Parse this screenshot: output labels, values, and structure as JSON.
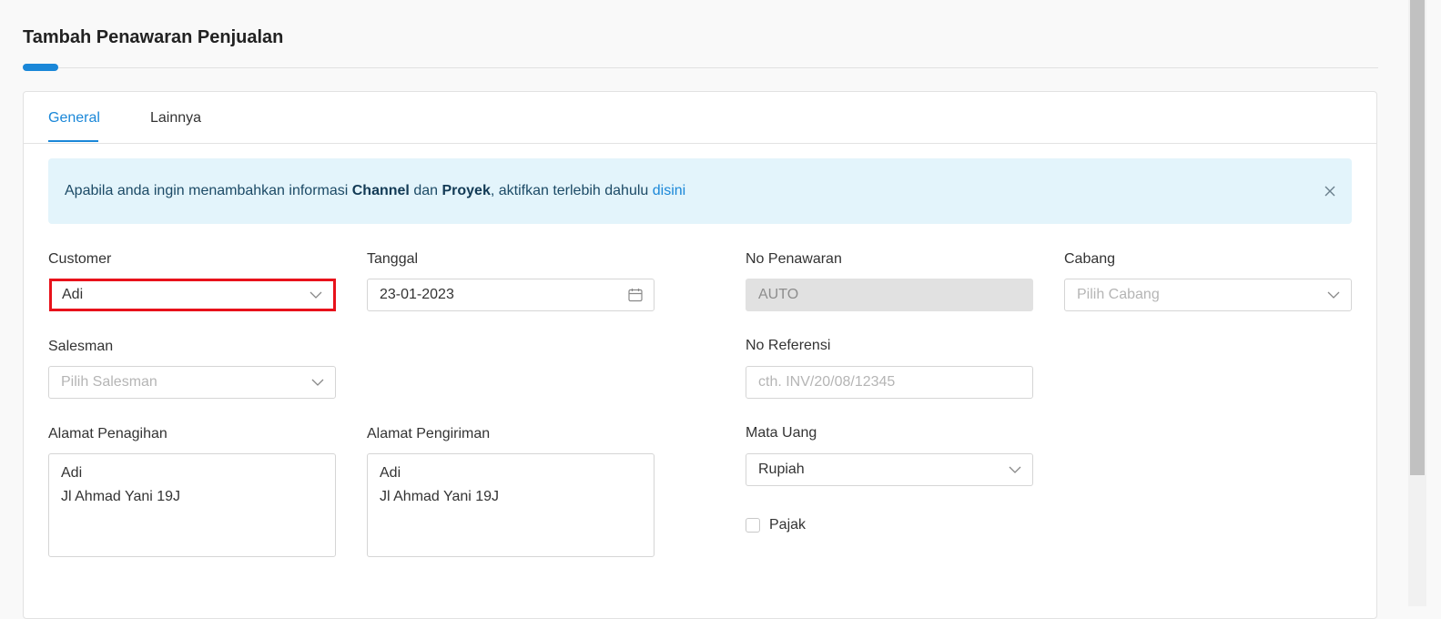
{
  "page_title": "Tambah Penawaran Penjualan",
  "tabs": [
    {
      "label": "General",
      "active": true
    },
    {
      "label": "Lainnya",
      "active": false
    }
  ],
  "alert": {
    "text_before": "Apabila anda ingin menambahkan informasi ",
    "channel": "Channel",
    "and": " dan ",
    "proyek": "Proyek",
    "text_after": ", aktifkan terlebih dahulu ",
    "link": "disini",
    "close_icon": "close-icon"
  },
  "form": {
    "customer": {
      "label": "Customer",
      "value": "Adi"
    },
    "tanggal": {
      "label": "Tanggal",
      "value": "23-01-2023"
    },
    "no_penawaran": {
      "label": "No Penawaran",
      "value": "AUTO"
    },
    "cabang": {
      "label": "Cabang",
      "placeholder": "Pilih Cabang"
    },
    "salesman": {
      "label": "Salesman",
      "placeholder": "Pilih Salesman"
    },
    "no_referensi": {
      "label": "No Referensi",
      "placeholder": "cth. INV/20/08/12345"
    },
    "alamat_penagihan": {
      "label": "Alamat Penagihan",
      "line1": "Adi",
      "line2": "Jl Ahmad Yani 19J"
    },
    "alamat_pengiriman": {
      "label": "Alamat Pengiriman",
      "line1": "Adi",
      "line2": "Jl Ahmad Yani 19J"
    },
    "mata_uang": {
      "label": "Mata Uang",
      "value": "Rupiah"
    },
    "pajak": {
      "label": "Pajak",
      "checked": false
    }
  },
  "colors": {
    "accent": "#1a87d8",
    "highlight": "#e8121b",
    "alert_bg": "#e3f4fb"
  }
}
